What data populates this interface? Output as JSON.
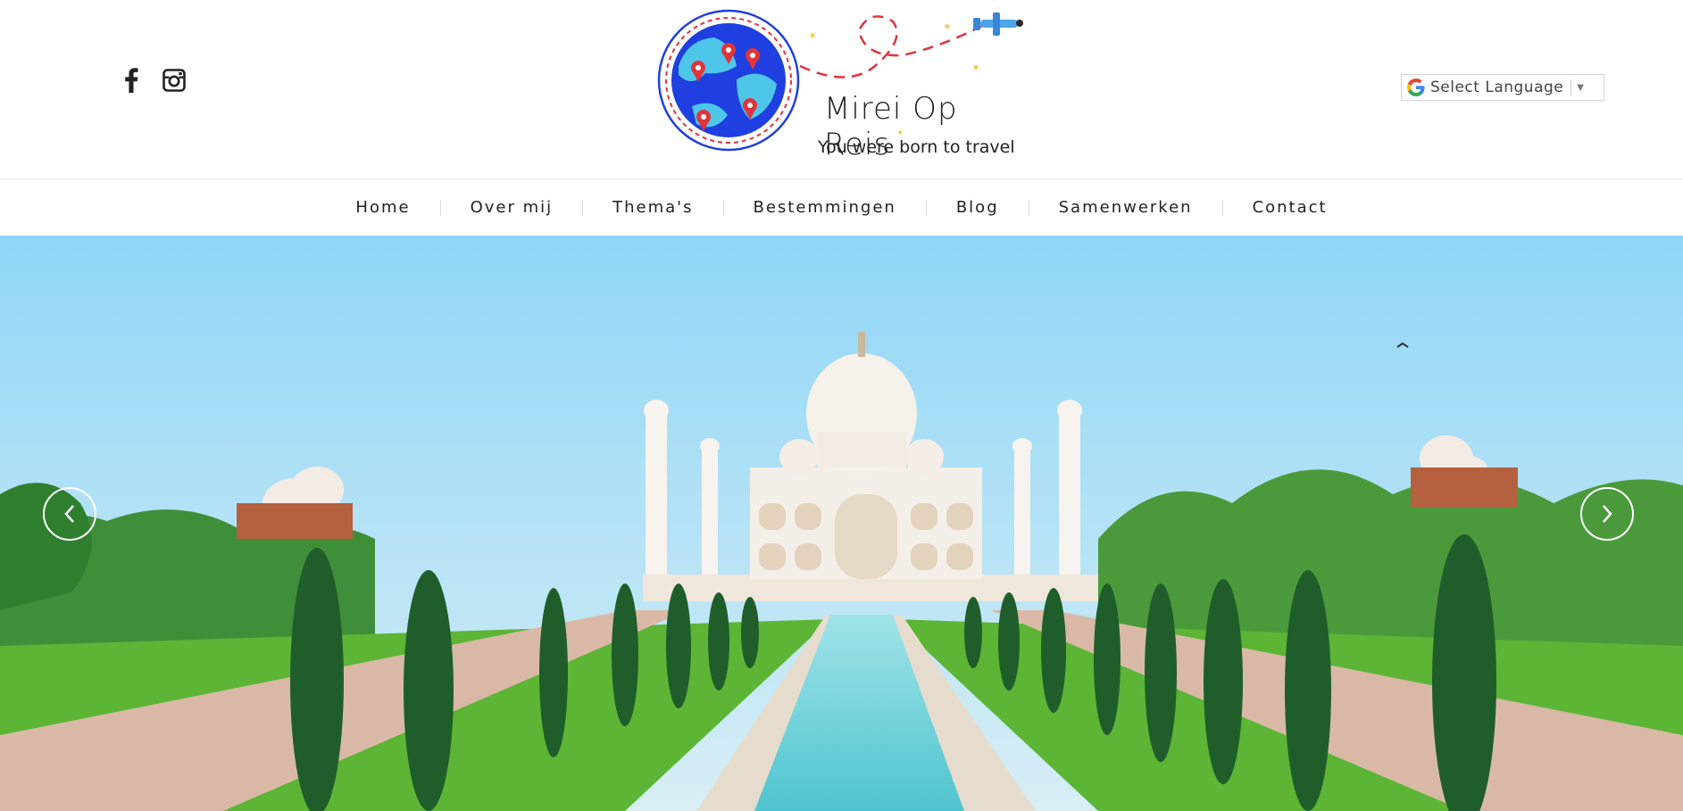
{
  "social": {
    "facebook_icon": "facebook-icon",
    "instagram_icon": "instagram-icon"
  },
  "logo": {
    "brand": "Mirei Op Reis",
    "tagline": "You were born to travel"
  },
  "language": {
    "label": "Select Language",
    "arrow": "▼"
  },
  "nav": {
    "items": [
      "Home",
      "Over mij",
      "Thema's",
      "Bestemmingen",
      "Blog",
      "Samenwerken",
      "Contact"
    ]
  },
  "hero": {
    "prev_icon": "chevron-left-icon",
    "next_icon": "chevron-right-icon"
  },
  "colors": {
    "accent_red": "#e0343b",
    "globe_blue": "#1f3fe0",
    "sky": "#9fdcf7",
    "grass": "#4aa52a"
  }
}
